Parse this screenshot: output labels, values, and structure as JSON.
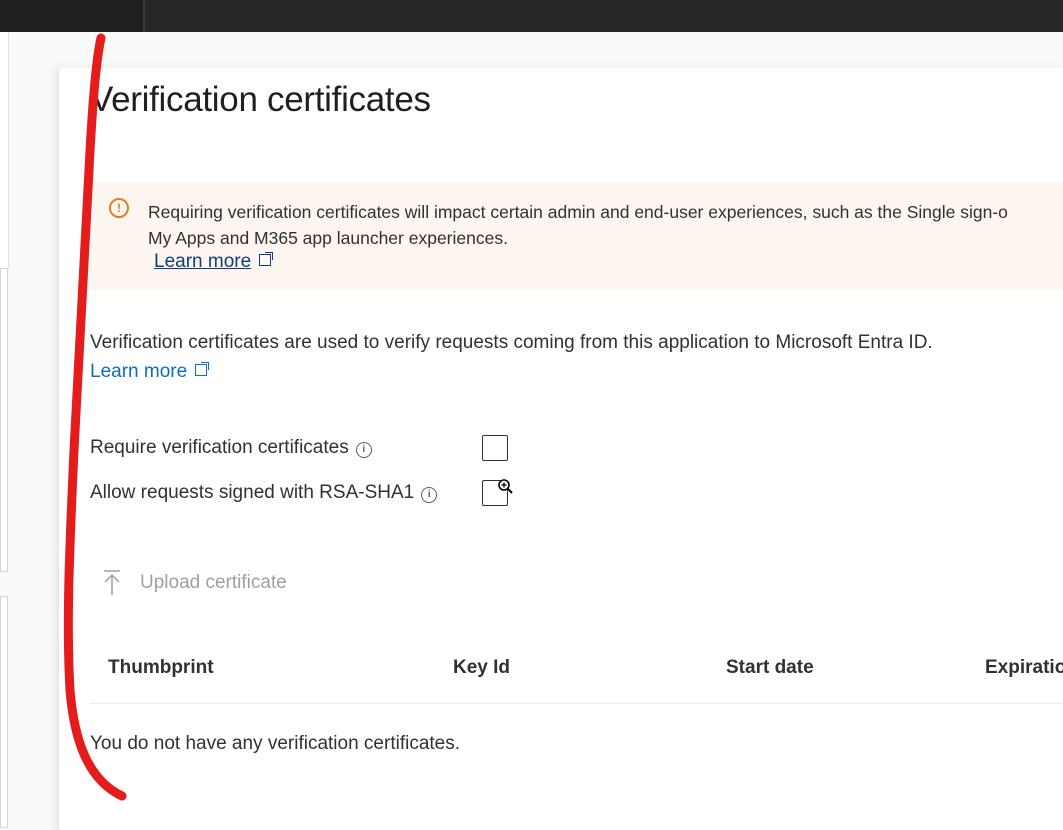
{
  "page": {
    "title": "Verification certificates"
  },
  "banner": {
    "icon": "warning-circle-icon",
    "text_line1": "Requiring verification certificates will impact certain admin and end-user experiences, such as the Single sign-o",
    "text_line2": "My Apps and M365 app launcher experiences.",
    "link_label": "Learn more",
    "background": "#fdf6f0",
    "accent": "#d9822b"
  },
  "description": {
    "text": "Verification certificates are used to verify requests coming from this application to Microsoft Entra ID.",
    "link_label": "Learn more"
  },
  "options": [
    {
      "label": "Require verification certificates",
      "checked": false
    },
    {
      "label": "Allow requests signed with RSA-SHA1",
      "checked": false
    }
  ],
  "toolbar": {
    "upload_label": "Upload certificate",
    "upload_icon": "upload-arrow-icon"
  },
  "table": {
    "columns": [
      "Thumbprint",
      "Key Id",
      "Start date",
      "Expiratio"
    ],
    "empty_message": "You do not have any verification certificates."
  },
  "colors": {
    "link": "#0f6cbd",
    "annotation": "#e51c1c"
  }
}
